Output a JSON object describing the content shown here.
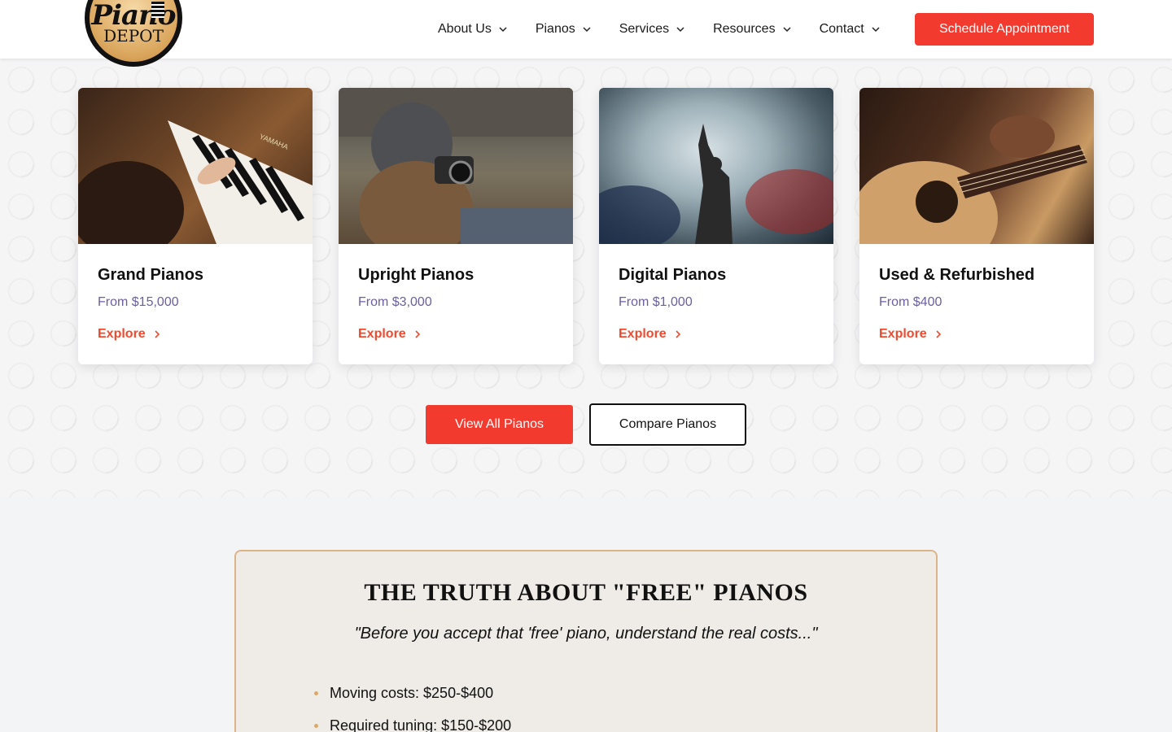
{
  "header": {
    "logo": {
      "script": "Piano",
      "depot": "DEPOT"
    },
    "nav": [
      {
        "label": "About Us"
      },
      {
        "label": "Pianos"
      },
      {
        "label": "Services"
      },
      {
        "label": "Resources"
      },
      {
        "label": "Contact"
      }
    ],
    "cta_label": "Schedule Appointment",
    "colors": {
      "accent": "#f33a2f"
    }
  },
  "cards": [
    {
      "title": "Grand Pianos",
      "price": "From $15,000",
      "link": "Explore",
      "image_brand": "YAMAHA"
    },
    {
      "title": "Upright Pianos",
      "price": "From $3,000",
      "link": "Explore"
    },
    {
      "title": "Digital Pianos",
      "price": "From $1,000",
      "link": "Explore"
    },
    {
      "title": "Used & Refurbished",
      "price": "From $400",
      "link": "Explore"
    }
  ],
  "buttons": {
    "view_all": "View All Pianos",
    "compare": "Compare Pianos"
  },
  "truth": {
    "title": "THE TRUTH ABOUT \"FREE\" PIANOS",
    "quote": "\"Before you accept that 'free' piano, understand the real costs...\"",
    "items": [
      "Moving costs: $250-$400",
      "Required tuning: $150-$200"
    ]
  }
}
